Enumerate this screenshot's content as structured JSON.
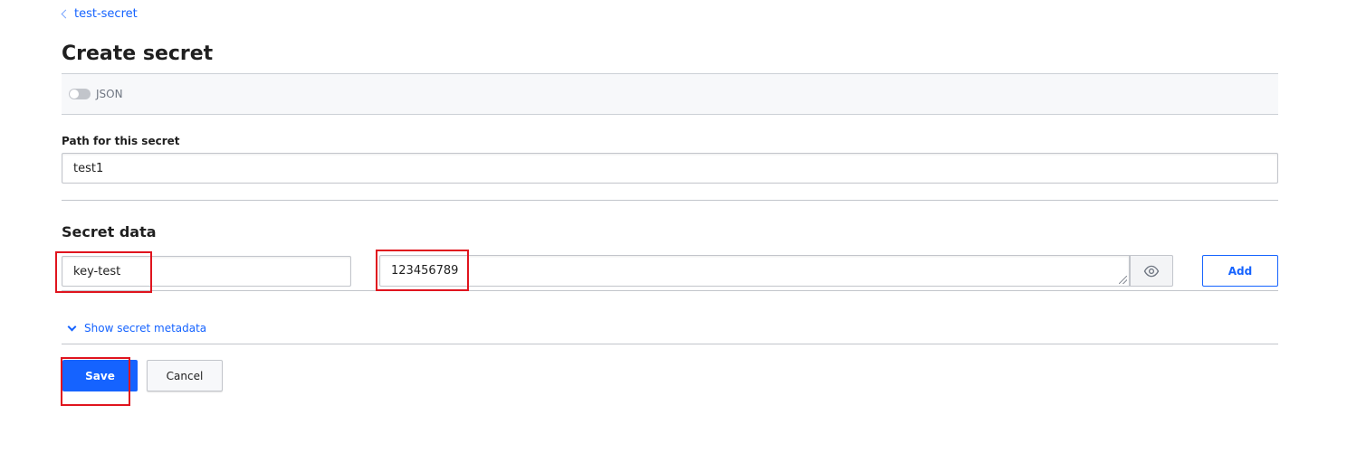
{
  "breadcrumb": {
    "label": "test-secret",
    "icon": "chevron-left-icon"
  },
  "page": {
    "title": "Create secret"
  },
  "json_toggle": {
    "label": "JSON",
    "enabled": false
  },
  "path": {
    "label": "Path for this secret",
    "value": "test1"
  },
  "secret_data": {
    "title": "Secret data",
    "key_value": "key-test",
    "secret_value": "123456789",
    "reveal_icon": "eye-icon",
    "add_label": "Add"
  },
  "metadata": {
    "label": "Show secret metadata",
    "icon": "chevron-down-icon"
  },
  "actions": {
    "save_label": "Save",
    "cancel_label": "Cancel"
  },
  "colors": {
    "accent": "#1563ff",
    "highlight": "#e0141e"
  }
}
